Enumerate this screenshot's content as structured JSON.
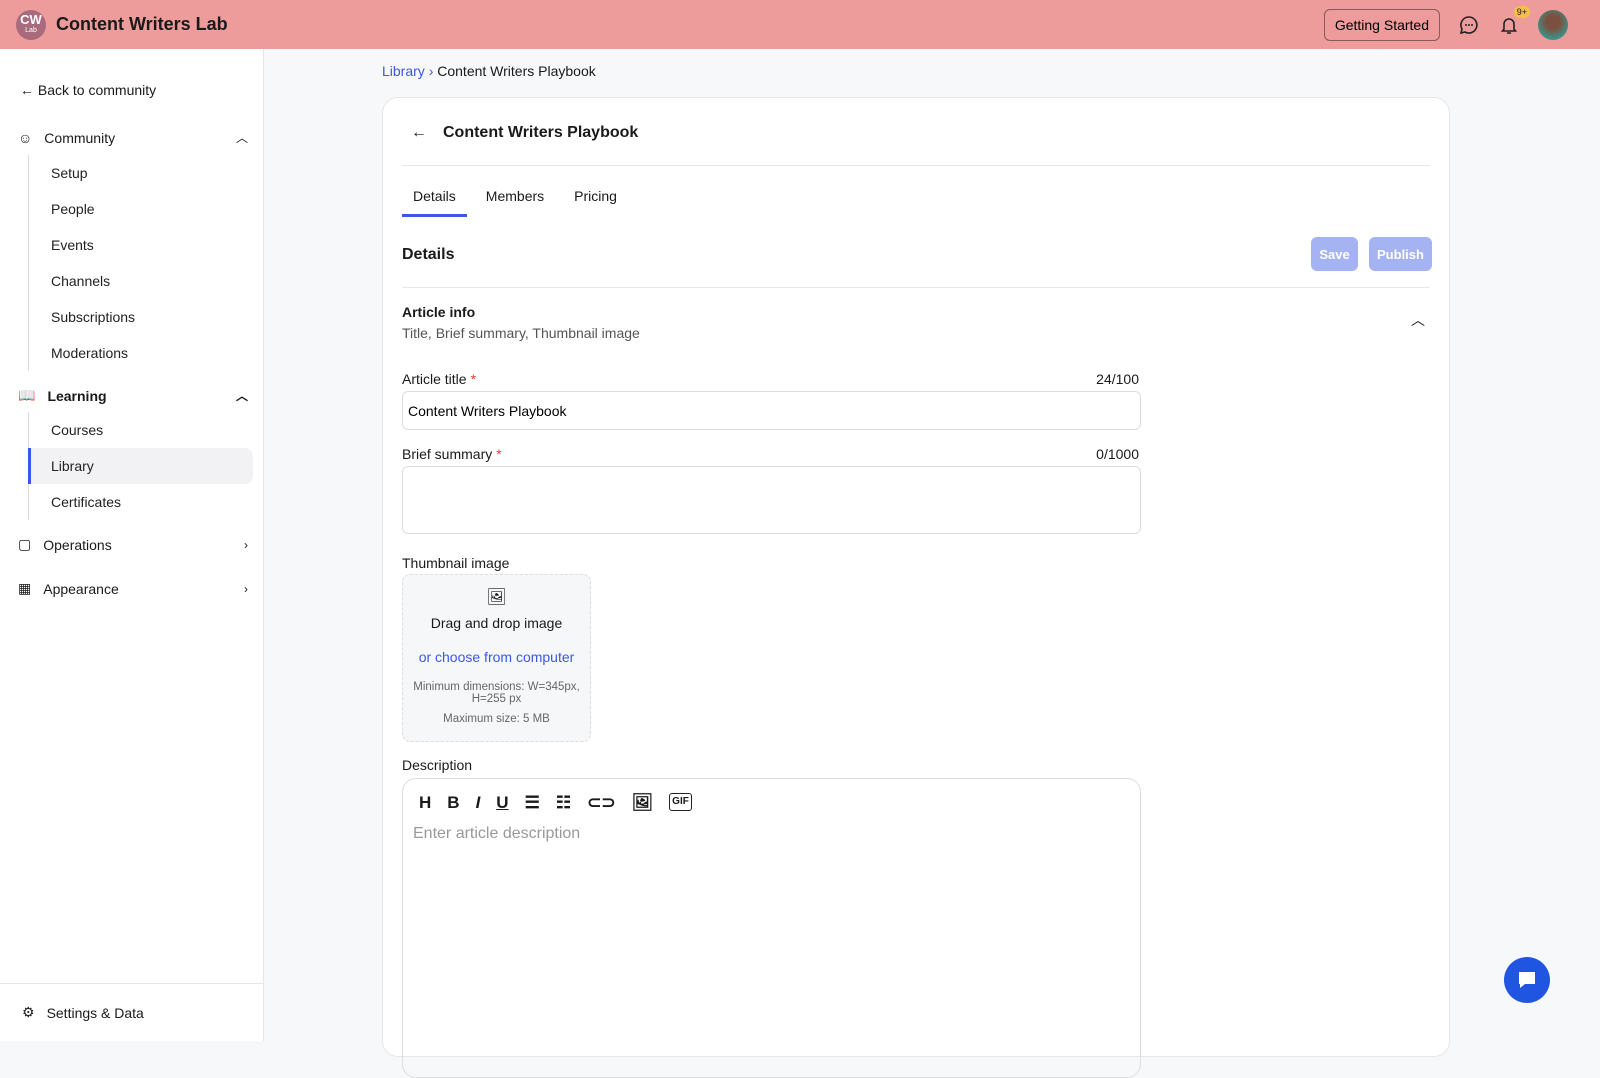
{
  "header": {
    "logo_text": "CW",
    "logo_sub": "Lab",
    "brand": "Content Writers Lab",
    "getting_started": "Getting Started",
    "notif_badge": "9+"
  },
  "sidebar": {
    "back": "Back to community",
    "community": {
      "label": "Community",
      "items": [
        "Setup",
        "People",
        "Events",
        "Channels",
        "Subscriptions",
        "Moderations"
      ]
    },
    "learning": {
      "label": "Learning",
      "items": [
        "Courses",
        "Library",
        "Certificates"
      ]
    },
    "operations": "Operations",
    "appearance": "Appearance",
    "settings": "Settings & Data"
  },
  "breadcrumb": {
    "root": "Library",
    "current": "Content Writers Playbook"
  },
  "card": {
    "title": "Content Writers Playbook",
    "tabs": [
      "Details",
      "Members",
      "Pricing"
    ],
    "section_title": "Details",
    "save": "Save",
    "publish": "Publish",
    "article_info": {
      "title": "Article info",
      "subtitle": "Title, Brief summary, Thumbnail image"
    },
    "fields": {
      "title_label": "Article title",
      "title_value": "Content Writers Playbook",
      "title_count": "24/100",
      "summary_label": "Brief summary",
      "summary_value": "",
      "summary_count": "0/1000",
      "thumb_label": "Thumbnail image",
      "drag": "Drag and drop image",
      "choose": "or choose from computer",
      "min_dims": "Minimum dimensions: W=345px, H=255 px",
      "max_size": "Maximum size: 5 MB",
      "desc_label": "Description",
      "desc_placeholder": "Enter article description"
    }
  },
  "colors": {
    "header": "#ed9b9b",
    "accent": "#3a57e8"
  }
}
